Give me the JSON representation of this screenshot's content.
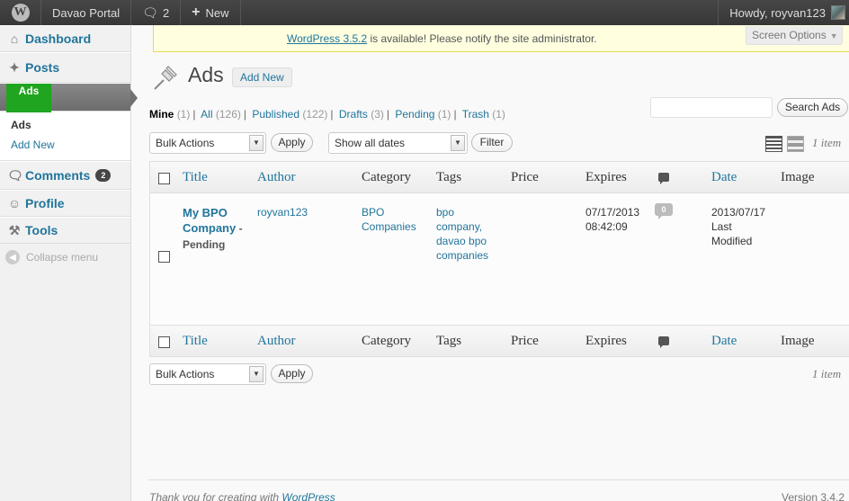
{
  "adminbar": {
    "site_name": "Davao Portal",
    "comments_count": "2",
    "new_label": "New",
    "howdy": "Howdy, royvan123"
  },
  "sidebar": {
    "dashboard": "Dashboard",
    "posts": "Posts",
    "ads_logo_text": "Ads",
    "ads_sub": [
      "Ads",
      "Add New"
    ],
    "comments": "Comments",
    "comments_badge": "2",
    "profile": "Profile",
    "tools": "Tools",
    "collapse": "Collapse menu"
  },
  "notice": {
    "link": "WordPress 3.5.2",
    "text": " is available! Please notify the site administrator."
  },
  "screen_options": "Screen Options",
  "heading": {
    "title": "Ads",
    "add_new": "Add New"
  },
  "filters": {
    "mine": "Mine",
    "mine_count": "(1)",
    "all": "All",
    "all_count": "(126)",
    "published": "Published",
    "published_count": "(122)",
    "drafts": "Drafts",
    "drafts_count": "(3)",
    "pending": "Pending",
    "pending_count": "(1)",
    "trash": "Trash",
    "trash_count": "(1)",
    "separator": "|"
  },
  "search": {
    "value": "",
    "button": "Search Ads"
  },
  "bulk": {
    "label": "Bulk Actions",
    "apply": "Apply"
  },
  "dates": {
    "label": "Show all dates",
    "filter": "Filter"
  },
  "items_count": "1 item",
  "columns": [
    "Title",
    "Author",
    "Category",
    "Tags",
    "Price",
    "Expires",
    "",
    "Date",
    "Image"
  ],
  "row": {
    "title": "My BPO Company",
    "title_sep": " - ",
    "state": "Pending",
    "author": "royvan123",
    "category": [
      "BPO",
      "Companies"
    ],
    "tags": [
      "bpo",
      "company,",
      "davao bpo",
      "companies"
    ],
    "price": "",
    "expires": [
      "07/17/2013",
      "08:42:09"
    ],
    "comments": "0",
    "date": [
      "2013/07/17",
      "Last",
      "Modified"
    ],
    "image": ""
  },
  "footer": {
    "thanks": "Thank you for creating with ",
    "wp_link": "WordPress",
    "version": "Version 3.4.2"
  }
}
